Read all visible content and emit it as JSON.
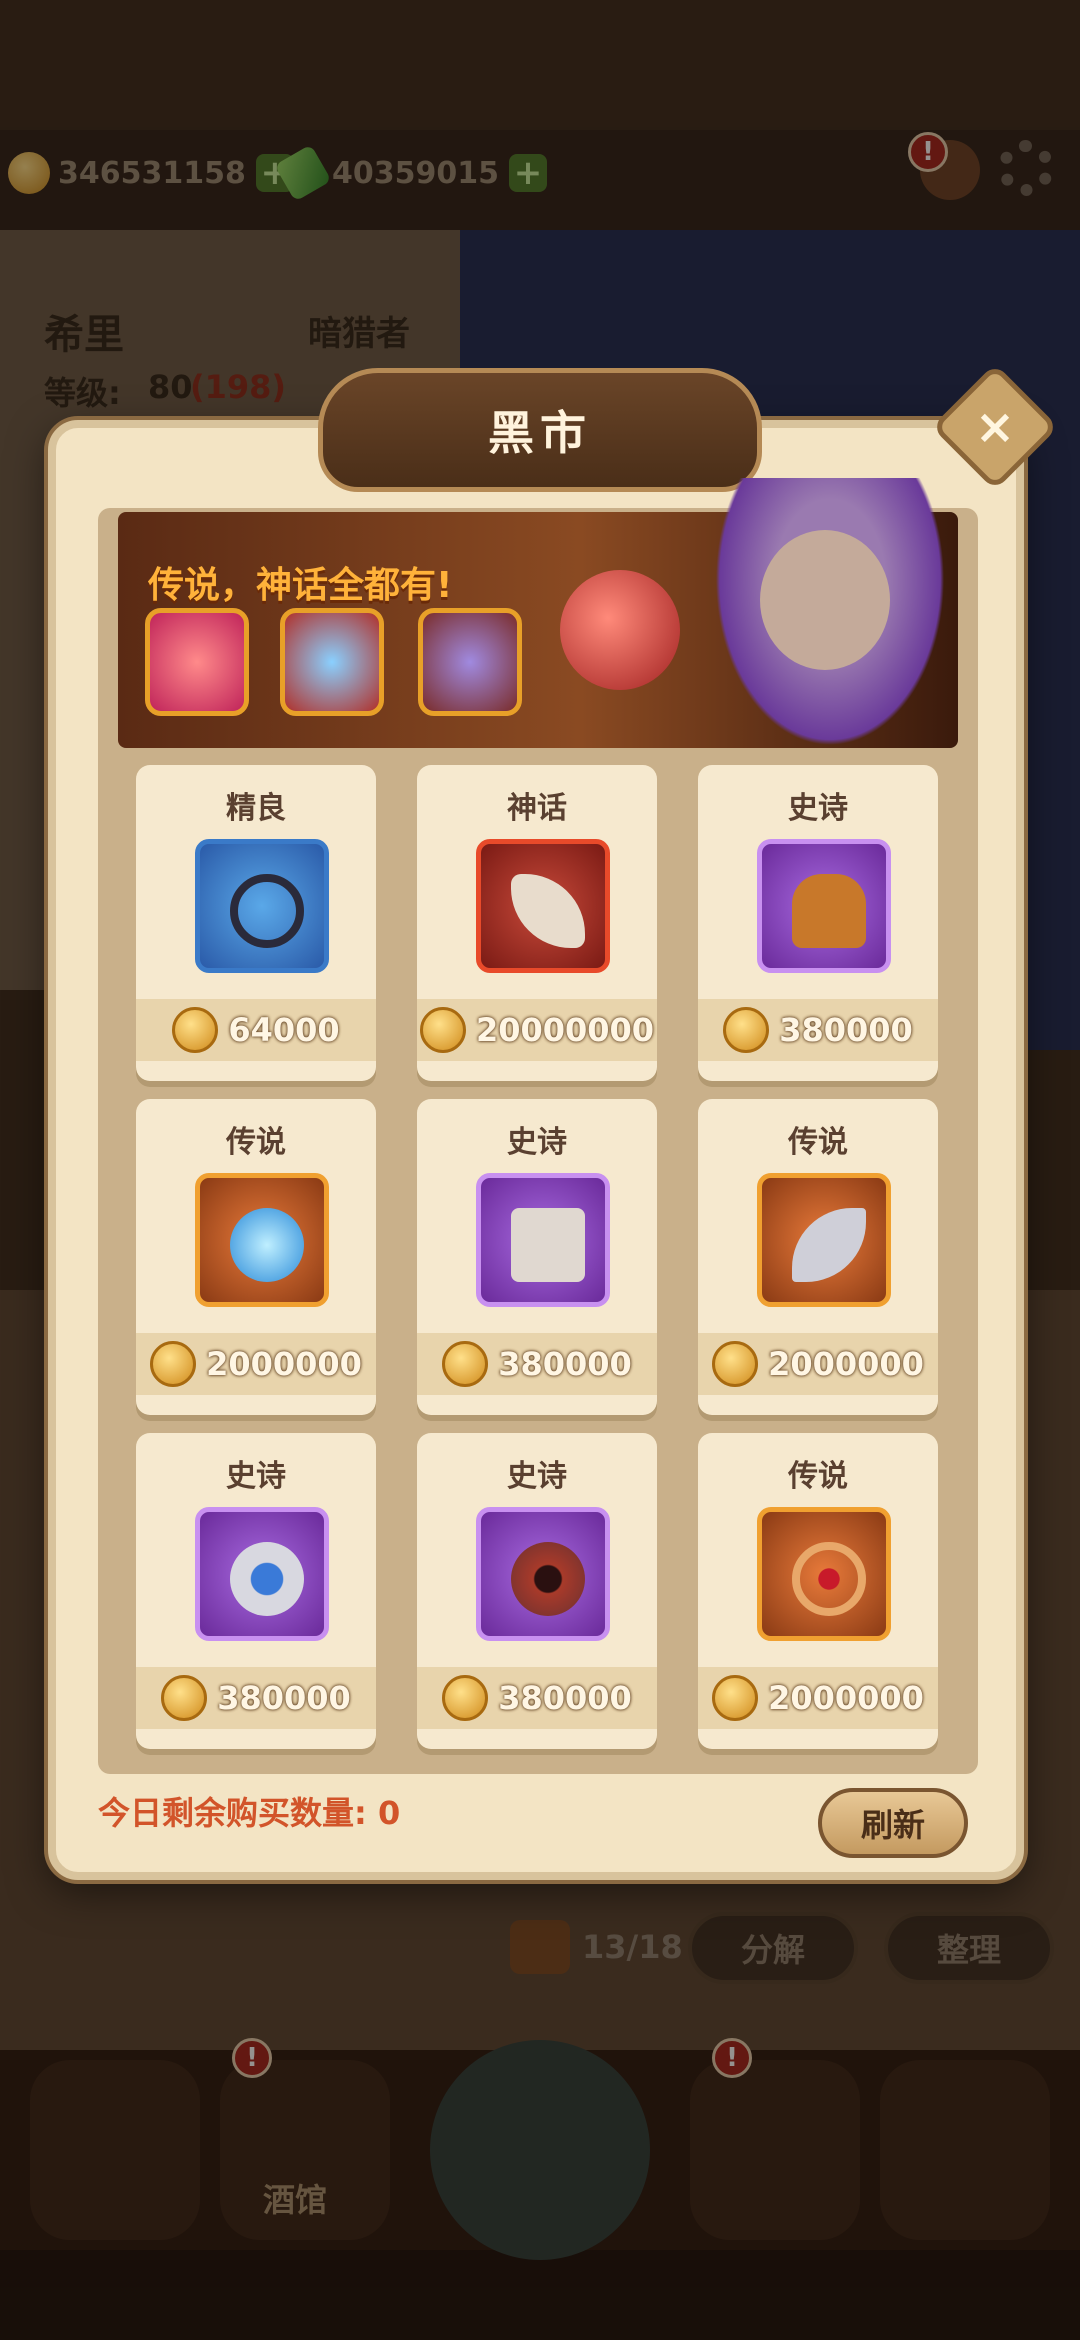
{
  "top_bar": {
    "gold_value": "346531158",
    "gem_value": "40359015",
    "alert_mark": "!"
  },
  "hero_panel": {
    "hero_name": "希里",
    "hero_class": "暗猎者",
    "level_label": "等级:",
    "level_value": "80",
    "level_extra": "(198)"
  },
  "dialog": {
    "title": "黑市",
    "close_label": "×",
    "banner_text": "传说，神话全都有!",
    "items": [
      {
        "rarity": "精良",
        "price": "64000",
        "icon": "ring-icon"
      },
      {
        "rarity": "神话",
        "price": "20000000",
        "icon": "dagger-icon"
      },
      {
        "rarity": "史诗",
        "price": "380000",
        "icon": "glove-icon"
      },
      {
        "rarity": "传说",
        "price": "2000000",
        "icon": "orb-icon"
      },
      {
        "rarity": "史诗",
        "price": "380000",
        "icon": "armor-icon"
      },
      {
        "rarity": "传说",
        "price": "2000000",
        "icon": "knife-icon"
      },
      {
        "rarity": "史诗",
        "price": "380000",
        "icon": "eye-ring-icon"
      },
      {
        "rarity": "史诗",
        "price": "380000",
        "icon": "amulet-icon"
      },
      {
        "rarity": "传说",
        "price": "2000000",
        "icon": "bracelet-icon"
      }
    ],
    "remaining_label": "今日剩余购买数量:",
    "remaining_value": "0",
    "refresh_label": "刷新"
  },
  "bag": {
    "count": "13/18",
    "decompose_label": "分解",
    "sort_label": "整理"
  },
  "nav": {
    "tavern_label": "酒馆"
  }
}
